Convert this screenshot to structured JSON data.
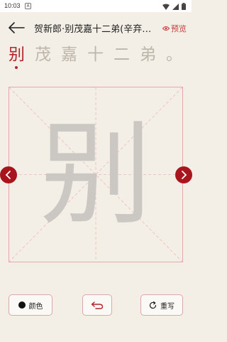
{
  "status_bar": {
    "time": "10:03",
    "notification_glyph": "A"
  },
  "header": {
    "title": "贺新郎·别茂嘉十二弟(辛弃…",
    "preview_label": "预览"
  },
  "characters": [
    {
      "char": "别",
      "active": true
    },
    {
      "char": "茂",
      "active": false
    },
    {
      "char": "嘉",
      "active": false
    },
    {
      "char": "十",
      "active": false
    },
    {
      "char": "二",
      "active": false
    },
    {
      "char": "弟",
      "active": false
    },
    {
      "char": "。",
      "active": false
    }
  ],
  "canvas": {
    "guide_char": "别"
  },
  "toolbar": {
    "color_label": "颜色",
    "reset_label": "重写"
  },
  "colors": {
    "accent": "#b3262a",
    "nav_button": "#a8151d",
    "grid_line": "#e7a6a8",
    "background": "#f3efe6"
  },
  "icons": [
    "back-arrow-icon",
    "eye-icon",
    "chevron-left-icon",
    "chevron-right-icon",
    "undo-icon",
    "reset-icon",
    "wifi-icon",
    "signal-icon",
    "battery-icon"
  ]
}
